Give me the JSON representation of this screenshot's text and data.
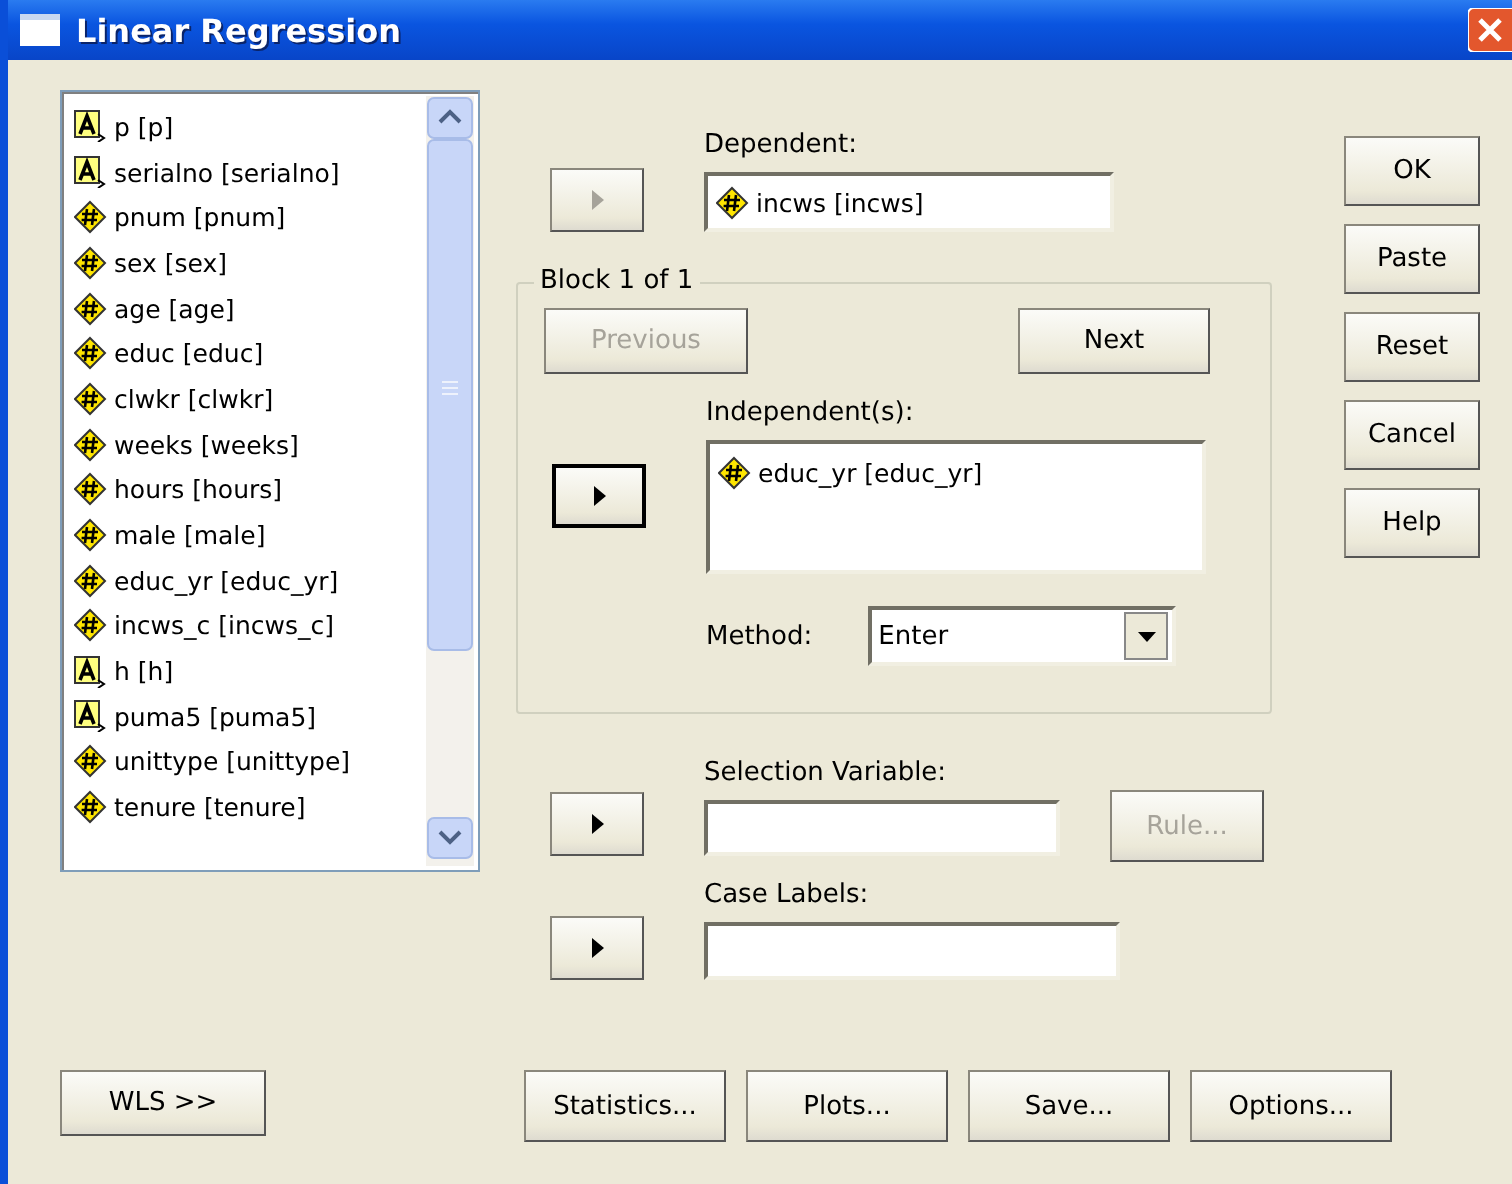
{
  "window": {
    "title": "Linear Regression"
  },
  "variables": [
    {
      "label": "p [p]",
      "kind": "string"
    },
    {
      "label": "serialno [serialno]",
      "kind": "string"
    },
    {
      "label": "pnum [pnum]",
      "kind": "scale"
    },
    {
      "label": "sex [sex]",
      "kind": "scale"
    },
    {
      "label": "age [age]",
      "kind": "scale"
    },
    {
      "label": "educ [educ]",
      "kind": "scale"
    },
    {
      "label": "clwkr [clwkr]",
      "kind": "scale"
    },
    {
      "label": "weeks [weeks]",
      "kind": "scale"
    },
    {
      "label": "hours [hours]",
      "kind": "scale"
    },
    {
      "label": "male [male]",
      "kind": "scale"
    },
    {
      "label": "educ_yr [educ_yr]",
      "kind": "scale"
    },
    {
      "label": "incws_c [incws_c]",
      "kind": "scale"
    },
    {
      "label": "h [h]",
      "kind": "string"
    },
    {
      "label": "puma5 [puma5]",
      "kind": "string"
    },
    {
      "label": "unittype [unittype]",
      "kind": "scale"
    },
    {
      "label": "tenure [tenure]",
      "kind": "scale"
    }
  ],
  "dependent": {
    "label": "Dependent:",
    "arrow_disabled": true,
    "value": {
      "label": "incws [incws]",
      "kind": "scale"
    }
  },
  "block": {
    "title": "Block 1 of 1",
    "previous": {
      "label": "Previous",
      "disabled": true
    },
    "next": {
      "label": "Next",
      "disabled": false
    },
    "independents": {
      "label": "Independent(s):",
      "arrow_focused": true,
      "items": [
        {
          "label": "educ_yr [educ_yr]",
          "kind": "scale"
        }
      ]
    },
    "method": {
      "label": "Method:",
      "value": "Enter"
    }
  },
  "selection_variable": {
    "label": "Selection Variable:",
    "rule": {
      "label": "Rule...",
      "disabled": true
    }
  },
  "case_labels": {
    "label": "Case Labels:"
  },
  "side_buttons": [
    {
      "label": "OK"
    },
    {
      "label": "Paste"
    },
    {
      "label": "Reset"
    },
    {
      "label": "Cancel"
    },
    {
      "label": "Help"
    }
  ],
  "wls_button": {
    "label": "WLS >>"
  },
  "bottom_buttons": [
    {
      "label": "Statistics..."
    },
    {
      "label": "Plots..."
    },
    {
      "label": "Save..."
    },
    {
      "label": "Options..."
    }
  ]
}
